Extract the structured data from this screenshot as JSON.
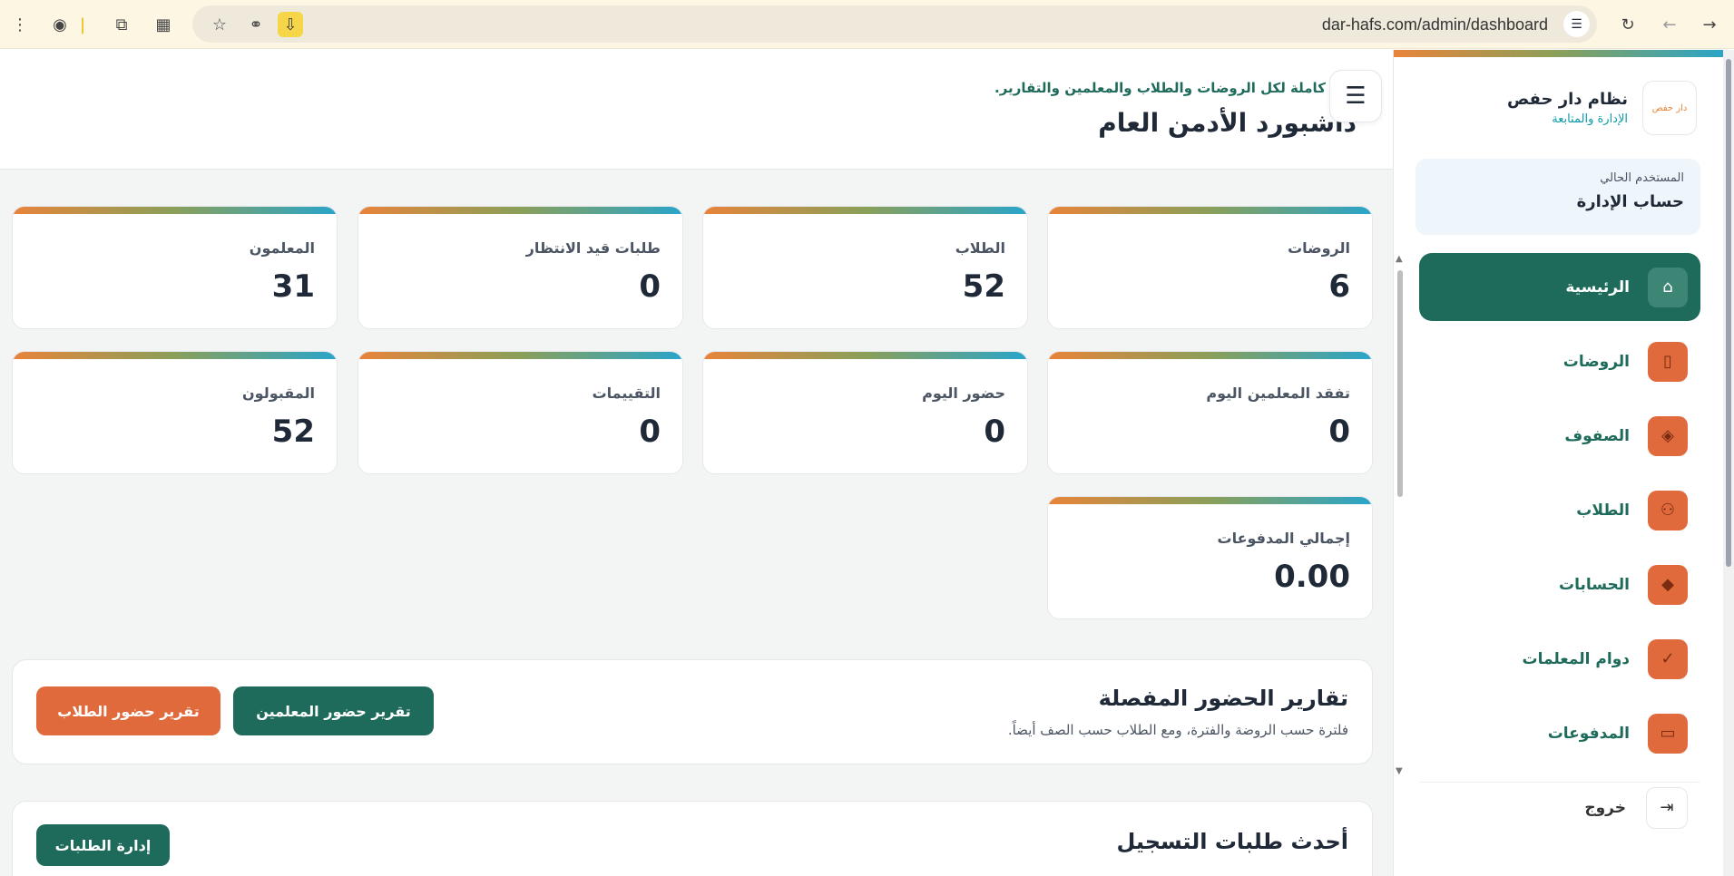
{
  "browser": {
    "url": "dar-hafs.com/admin/dashboard",
    "icons": [
      "menu-dots-icon",
      "extension-color-icon",
      "puzzle-icon",
      "qr-icon",
      "star-icon",
      "link-icon",
      "install-icon",
      "site-settings-icon",
      "reload-icon",
      "back-icon",
      "forward-icon"
    ]
  },
  "sidebar": {
    "brand_name": "نظام دار حفص",
    "brand_sub": "الإدارة والمتابعة",
    "logo_text": "دار حفص",
    "user_label": "المستخدم الحالي",
    "user_value": "حساب الإدارة",
    "items": [
      {
        "label": "الرئيسية",
        "icon": "home-icon",
        "active": true
      },
      {
        "label": "الروضات",
        "icon": "building-icon"
      },
      {
        "label": "الصفوف",
        "icon": "layers-icon"
      },
      {
        "label": "الطلاب",
        "icon": "users-icon"
      },
      {
        "label": "الحسابات",
        "icon": "graduation-cap-icon"
      },
      {
        "label": "دوام المعلمات",
        "icon": "check-circle-icon"
      },
      {
        "label": "المدفوعات",
        "icon": "credit-card-icon"
      }
    ],
    "logout_label": "خروج"
  },
  "header": {
    "subtitle": "ة كاملة لكل الروضات والطلاب والمعلمين والتقارير.",
    "title": "داشبورد الأدمن العام"
  },
  "stats": [
    {
      "label": "الروضات",
      "value": "6"
    },
    {
      "label": "الطلاب",
      "value": "52"
    },
    {
      "label": "طلبات قيد الانتظار",
      "value": "0"
    },
    {
      "label": "المعلمون",
      "value": "31"
    },
    {
      "label": "تفقد المعلمين اليوم",
      "value": "0"
    },
    {
      "label": "حضور اليوم",
      "value": "0"
    },
    {
      "label": "التقييمات",
      "value": "0"
    },
    {
      "label": "المقبولون",
      "value": "52"
    },
    {
      "label": "إجمالي المدفوعات",
      "value": "0.00"
    }
  ],
  "reports": {
    "title": "تقارير الحضور المفصلة",
    "subtitle": "فلترة حسب الروضة والفترة، ومع الطلاب حسب الصف أيضاً.",
    "teachers_button": "تقرير حضور المعلمين",
    "students_button": "تقرير حضور الطلاب"
  },
  "requests": {
    "title": "أحدث طلبات التسجيل",
    "manage_button": "إدارة الطلبات"
  }
}
